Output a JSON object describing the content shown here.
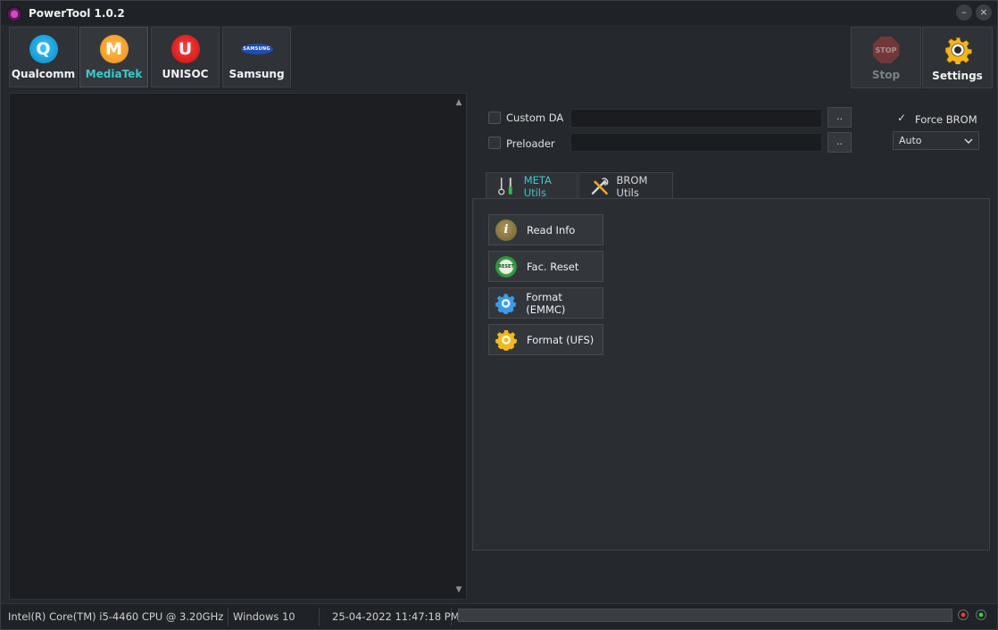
{
  "window": {
    "title": "PowerTool 1.0.2",
    "minimize": "–",
    "close": "×"
  },
  "vendors": [
    {
      "label": "Qualcomm",
      "logo": "Q",
      "active": false
    },
    {
      "label": "MediaTek",
      "logo": "M",
      "active": true
    },
    {
      "label": "UNISOC",
      "logo": "U",
      "active": false
    },
    {
      "label": "Samsung",
      "logo": "SAMSUNG",
      "active": false
    }
  ],
  "toolbar": {
    "stop_label": "Stop",
    "stop_sign": "STOP",
    "settings_label": "Settings"
  },
  "config": {
    "custom_da_label": "Custom DA",
    "custom_da_value": "",
    "preloader_label": "Preloader",
    "preloader_value": "",
    "browse_label": "..",
    "force_brom_label": "Force BROM",
    "force_brom_checked": true,
    "checkmark": "✓",
    "mode_selected": "Auto"
  },
  "tabs": [
    {
      "label": "META Utils",
      "active": true
    },
    {
      "label": "BROM Utils",
      "active": false
    }
  ],
  "actions": [
    {
      "label": "Read Info",
      "icon": "i"
    },
    {
      "label": "Fac. Reset",
      "icon": "RESET"
    },
    {
      "label": "Format (EMMC)",
      "icon": "gear"
    },
    {
      "label": "Format (UFS)",
      "icon": "gear"
    }
  ],
  "status": {
    "cpu": "Intel(R) Core(TM) i5-4460  CPU @ 3.20GHz",
    "os": "Windows 10",
    "datetime": "25-04-2022 11:47:18 PM",
    "progress": 0
  },
  "colors": {
    "accent": "#3fc6c9",
    "background": "#25282d",
    "panel": "#2a2d32"
  }
}
